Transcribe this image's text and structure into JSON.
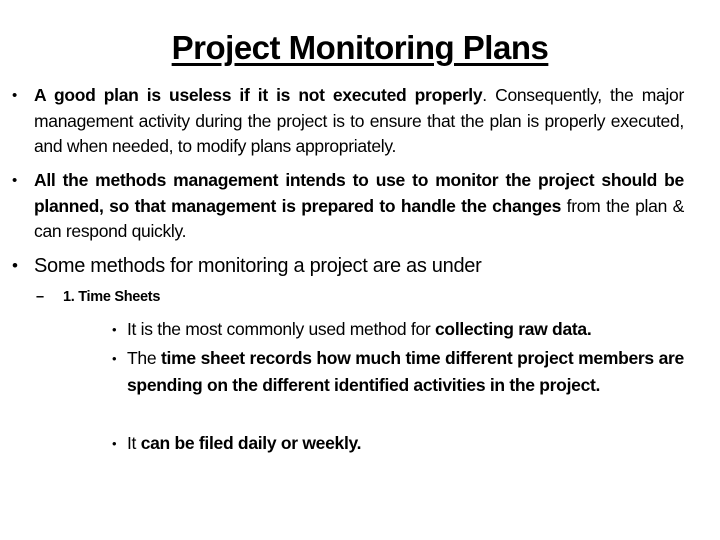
{
  "slide": {
    "title": "Project Monitoring Plans",
    "bullets": [
      {
        "bold_lead": "A good plan is useless if it is not executed properly",
        "rest": ". Consequently, the major management activity during the project is to ensure that the plan is properly executed, and when needed, to modify plans appropriately."
      },
      {
        "bold_lead": "All the methods management intends to use to monitor the project should be planned, so that management is prepared to handle the changes",
        "rest": " from the plan & can respond quickly."
      },
      {
        "text": "Some methods for monitoring a project are as under"
      }
    ],
    "sub_item": {
      "marker": "–",
      "text": "1. Time Sheets"
    },
    "sub_bullets": [
      {
        "lead": "It is the most commonly used method for ",
        "bold": "collecting raw data."
      },
      {
        "lead": "The ",
        "bold": "time sheet records how much time different project members are spending on the different identified activities in the project."
      },
      {
        "lead": "It ",
        "bold": "can be filed daily or weekly."
      }
    ],
    "bullet_glyph": "•"
  }
}
